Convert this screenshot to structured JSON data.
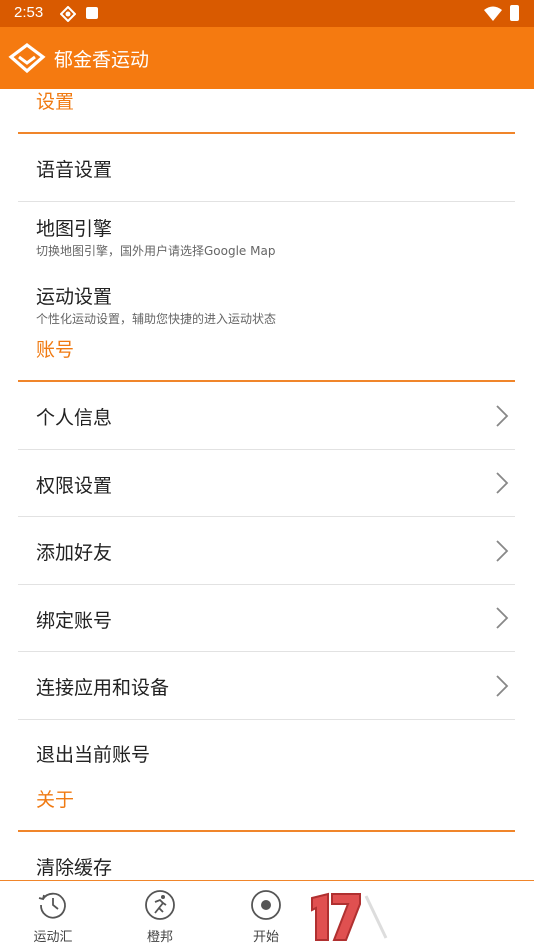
{
  "status": {
    "time": "2:53"
  },
  "appbar": {
    "title": "郁金香运动"
  },
  "sections": {
    "settings": "设置",
    "account": "账号",
    "about": "关于"
  },
  "items": {
    "voice": {
      "label": "语音设置"
    },
    "map": {
      "label": "地图引擎",
      "sub": "切换地图引擎，国外用户请选择Google Map"
    },
    "sport": {
      "label": "运动设置",
      "sub": "个性化运动设置，辅助您快捷的进入运动状态"
    },
    "profile": {
      "label": "个人信息"
    },
    "permission": {
      "label": "权限设置"
    },
    "friend": {
      "label": "添加好友"
    },
    "bind": {
      "label": "绑定账号"
    },
    "connect": {
      "label": "连接应用和设备"
    },
    "logout": {
      "label": "退出当前账号"
    },
    "cache": {
      "label": "清除缓存"
    }
  },
  "tabs": [
    {
      "label": "运动汇",
      "icon": "history-icon"
    },
    {
      "label": "橙邦",
      "icon": "runner-icon"
    },
    {
      "label": "开始",
      "icon": "record-icon"
    }
  ],
  "colors": {
    "accent": "#f57a10",
    "statusbar": "#d95a00"
  }
}
